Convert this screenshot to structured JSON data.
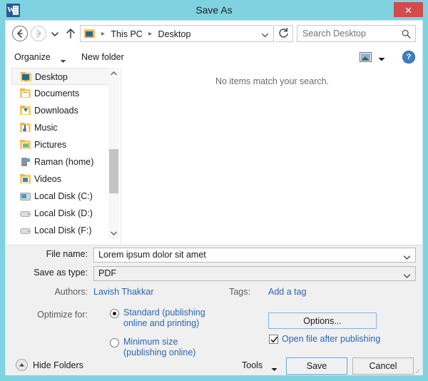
{
  "window": {
    "title": "Save As",
    "app_icon": "word-icon",
    "close_label": "✕",
    "frame_color": "#7fd3e0",
    "close_color": "#d44b4b"
  },
  "navbar": {
    "back_icon": "back-arrow-icon",
    "forward_icon": "forward-arrow-icon",
    "recent_icon": "recent-locations-chevron-icon",
    "up_icon": "up-arrow-icon",
    "breadcrumb": {
      "folder_icon": "desktop-folder-icon",
      "items": [
        "This PC",
        "Desktop"
      ],
      "separator": "▸",
      "dropdown_icon": "chevron-down-icon"
    },
    "refresh_icon": "refresh-icon",
    "search": {
      "placeholder": "Search Desktop",
      "value": "",
      "icon": "search-icon"
    }
  },
  "commandbar": {
    "organize_label": "Organize",
    "organize_caret": "caret-down-icon",
    "new_folder_label": "New folder",
    "view_icon": "change-view-icon",
    "view_caret": "caret-down-icon",
    "help_icon": "help-icon",
    "help_glyph": "?"
  },
  "navpane": {
    "items": [
      {
        "label": "Desktop",
        "icon": "desktop-icon",
        "selected": true
      },
      {
        "label": "Documents",
        "icon": "documents-folder-icon",
        "selected": false
      },
      {
        "label": "Downloads",
        "icon": "downloads-folder-icon",
        "selected": false
      },
      {
        "label": "Music",
        "icon": "music-folder-icon",
        "selected": false
      },
      {
        "label": "Pictures",
        "icon": "pictures-folder-icon",
        "selected": false
      },
      {
        "label": "Raman (home)",
        "icon": "network-home-icon",
        "selected": false
      },
      {
        "label": "Videos",
        "icon": "videos-folder-icon",
        "selected": false
      },
      {
        "label": "Local Disk (C:)",
        "icon": "system-drive-icon",
        "selected": false
      },
      {
        "label": "Local Disk (D:)",
        "icon": "drive-icon",
        "selected": false
      },
      {
        "label": "Local Disk (F:)",
        "icon": "drive-icon",
        "selected": false
      }
    ],
    "scroll_up_icon": "scroll-up-arrow-icon",
    "scroll_down_icon": "scroll-down-arrow-icon"
  },
  "filelist": {
    "empty_message": "No items match your search."
  },
  "form": {
    "file_name_label": "File name:",
    "file_name_value": "Lorem ipsum dolor sit amet",
    "file_name_chevron": "chevron-down-icon",
    "save_as_type_label": "Save as type:",
    "save_as_type_value": "PDF",
    "save_as_type_chevron": "chevron-down-icon",
    "authors_label": "Authors:",
    "authors_value": "Lavish Thakkar",
    "tags_label": "Tags:",
    "tags_value": "Add a tag",
    "optimize_label": "Optimize for:",
    "optimize_options": [
      {
        "label_line1": "Standard (publishing",
        "label_line2": "online and printing)",
        "selected": true
      },
      {
        "label_line1": "Minimum size",
        "label_line2": "(publishing online)",
        "selected": false
      }
    ],
    "options_button": "Options...",
    "open_after_publishing_label": "Open file after publishing",
    "open_after_publishing_checked": true,
    "checkbox_icon": "checkmark-icon"
  },
  "footer": {
    "hide_folders_label": "Hide Folders",
    "hide_folders_icon": "collapse-up-icon",
    "tools_label": "Tools",
    "tools_caret": "caret-down-icon",
    "save_label": "Save",
    "cancel_label": "Cancel",
    "resize_grip_icon": "resize-grip-icon"
  },
  "colors": {
    "frame": "#7fd3e0",
    "close": "#d44b4b",
    "link": "#2a66b5",
    "panel": "#f0f0f0",
    "focus": "#5a9fd4"
  }
}
